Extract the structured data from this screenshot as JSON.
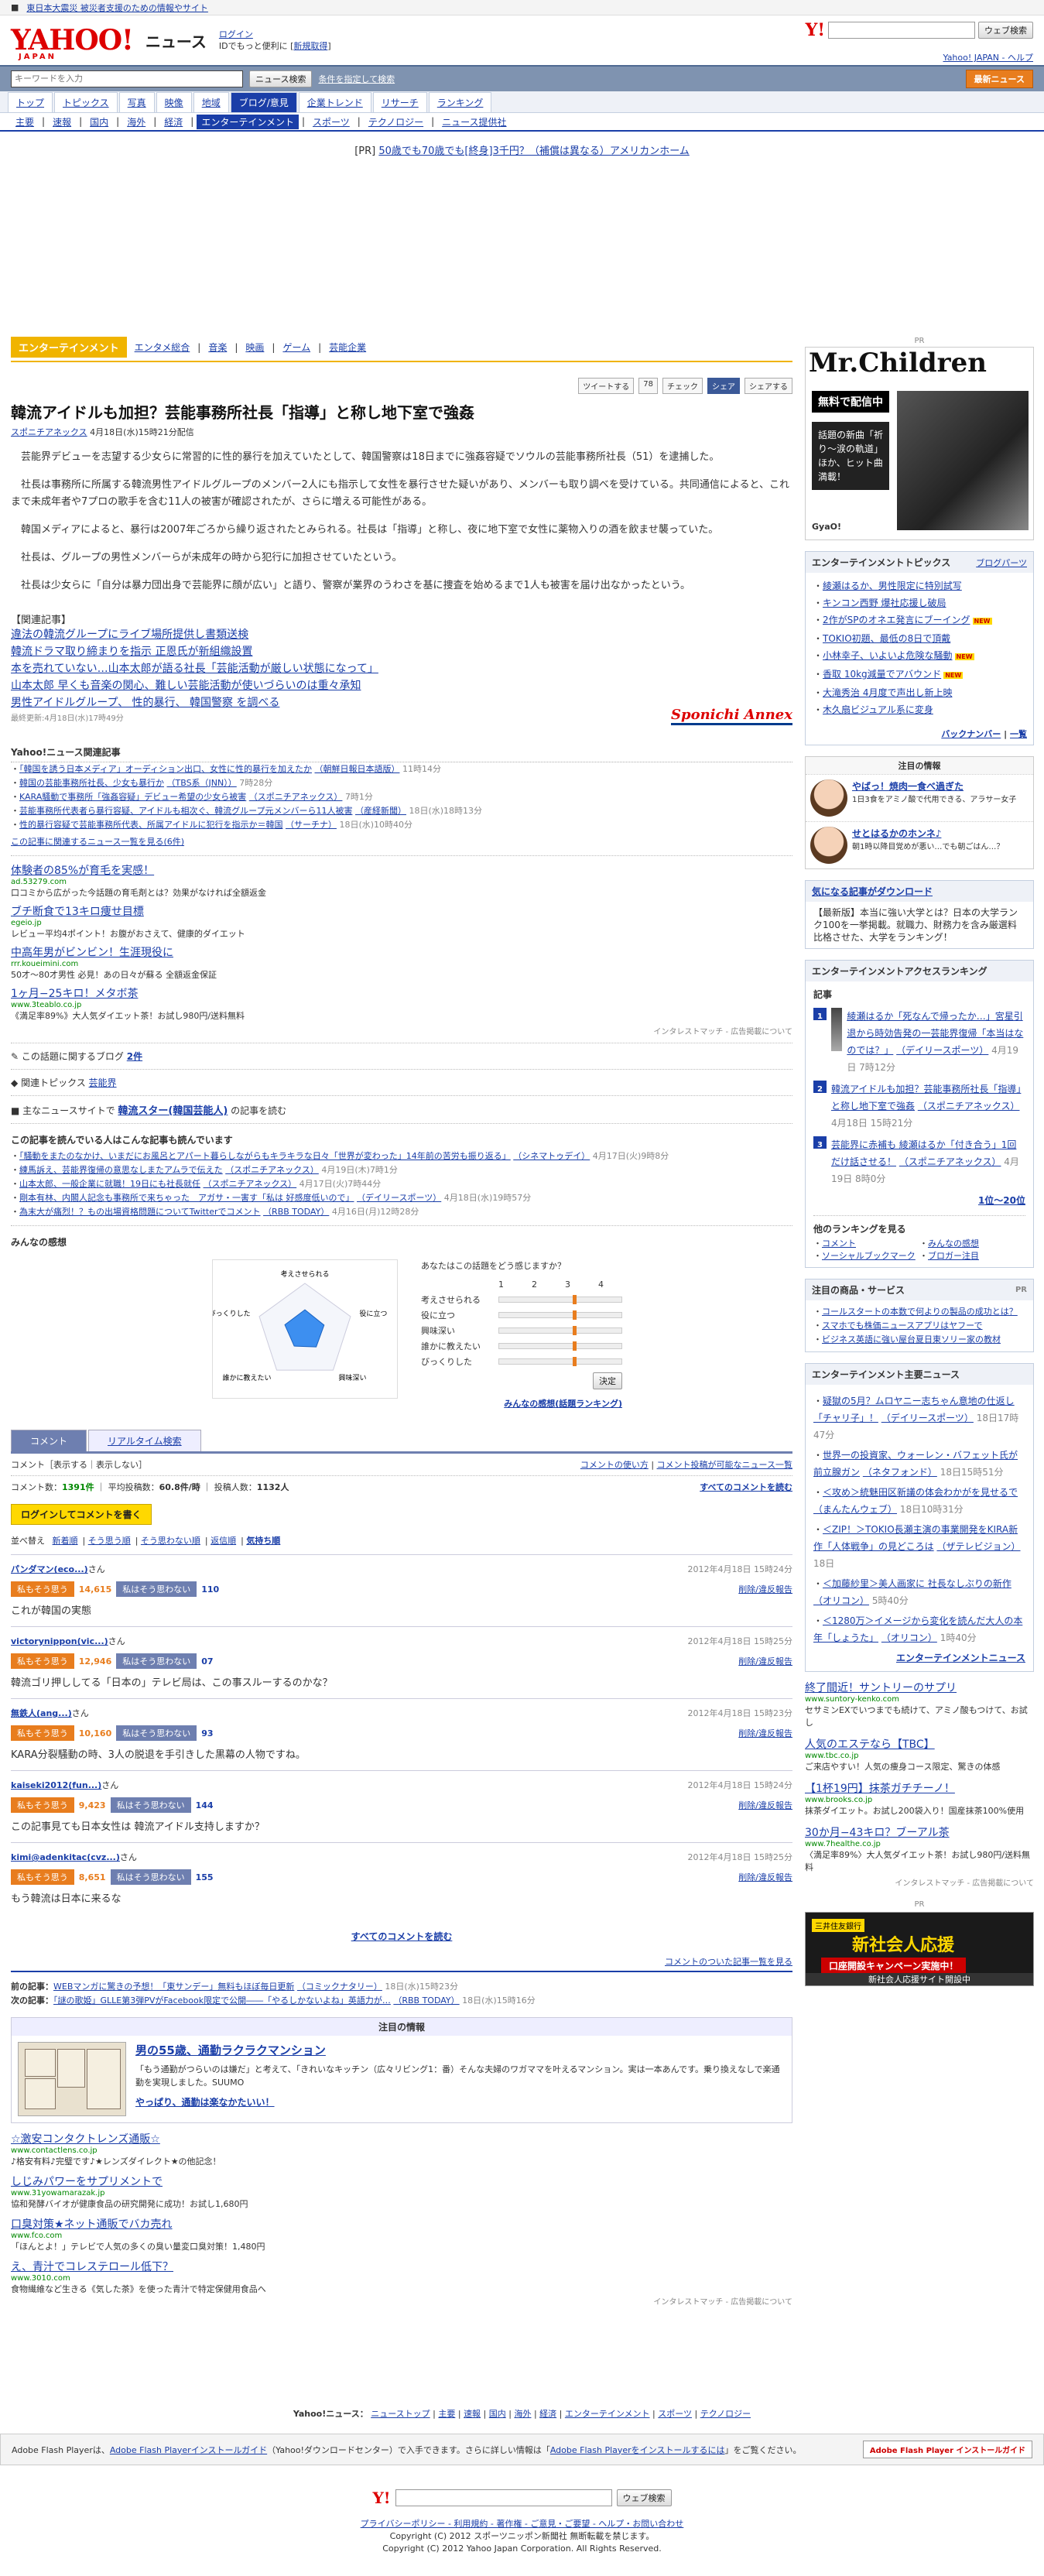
{
  "top_strip": {
    "link1": "東日本大震災 被災者支援のための情報やサイト"
  },
  "header": {
    "logo": "YAHOO!",
    "logo_sub": "JAPAN",
    "site": "ニュース",
    "login": "ログイン",
    "login_sub": "IDでもっと便利に",
    "register": "新規取得",
    "ysearch_btn": "ウェブ検索",
    "links": "Yahoo! JAPAN - ヘルプ"
  },
  "search": {
    "placeholder": "キーワードを入力",
    "btn": "ニュース検索",
    "cond": "条件を指定して検索",
    "fs_btn": "最新ニュース"
  },
  "nav1": [
    "トップ",
    "トピックス",
    "写真",
    "映像",
    "地域",
    "ブログ/意見",
    "企業トレンド",
    "リサーチ",
    "ランキング"
  ],
  "nav2": [
    "主要",
    "速報",
    "国内",
    "海外",
    "経済",
    "エンターテインメント",
    "スポーツ",
    "テクノロジー",
    "ニュース提供社"
  ],
  "pr_top": {
    "label": "[PR]",
    "text": "50歳でも70歳でも[終身]3千円？（補償は異なる）アメリカンホーム"
  },
  "cat": {
    "badge": "エンターテインメント",
    "links": [
      "エンタメ総合",
      "音楽",
      "映画",
      "ゲーム",
      "芸能企業"
    ]
  },
  "share": {
    "tweet": "ツイートする",
    "count": "78",
    "check": "チェック",
    "fb": "シェア",
    "y": "シェアする"
  },
  "article": {
    "title": "韓流アイドルも加担？芸能事務所社長「指導」と称し地下室で強姦",
    "source": "スポニチアネックス",
    "date": "4月18日(水)15時21分配信",
    "p1": "芸能界デビューを志望する少女らに常習的に性的暴行を加えていたとして、韓国警察は18日までに強姦容疑でソウルの芸能事務所社長（51）を逮捕した。",
    "p2": "社長は事務所に所属する韓流男性アイドルグループのメンバー2人にも指示して女性を暴行させた疑いがあり、メンバーも取り調べを受けている。共同通信によると、これまで未成年者や7プロの歌手を含む11人の被害が確認されたが、さらに増える可能性がある。",
    "p3": "韓国メディアによると、暴行は2007年ごろから繰り返されたとみられる。社長は「指導」と称し、夜に地下室で女性に薬物入りの酒を飲ませ襲っていた。",
    "p4": "社長は、グループの男性メンバーらが未成年の時から犯行に加担させていたという。",
    "p5": "社長は少女らに「自分は暴力団出身で芸能界に顔が広い」と語り、警察が業界のうわさを基に捜査を始めるまで1人も被害を届け出なかったという。",
    "rel_h": "【関連記事】",
    "rel": [
      "違法の韓流グループにライブ場所提供し書類送検",
      "韓流ドラマ取り締まりを指示 正恩氏が新組織設置",
      "本を売れていない…山本太郎が語る社長「芸能活動が厳しい状態になって」",
      "山本太郎 早くも音楽の関心、難しい芸能活動が使いづらいのは重々承知",
      "男性アイドルグループ、 性的暴行、 韓国警察 を調べる"
    ],
    "updated": "最終更新:4月18日(水)17時49分",
    "sponichi": "Sponichi Annex"
  },
  "yahoo_rel": {
    "h": "Yahoo!ニュース関連記事",
    "items": [
      {
        "t": "「韓国を誘う日本メディア」オーディション出口、女性に性的暴行を加えたか",
        "s": "（朝鮮日報日本語版）",
        "d": "11時14分"
      },
      {
        "t": "韓国の芸能事務所社長、少女も暴行か",
        "s": "（TBS系（JNN））",
        "d": "7時28分"
      },
      {
        "t": "KARA騒動で事務所「強姦容疑」デビュー希望の少女ら被害",
        "s": "（スポニチアネックス）",
        "d": "7時1分"
      },
      {
        "t": "芸能事務所代表者ら暴行容疑、アイドルも相次ぐ、韓流グループ元メンバーら11人被害",
        "s": "（産経新聞）",
        "d": "18日(水)18時13分"
      },
      {
        "t": "性的暴行容疑で芸能事務所代表、所属アイドルに犯行を指示か＝韓国",
        "s": "（サーチナ）",
        "d": "18日(水)10時40分"
      }
    ],
    "more": "この記事に関連するニュース一覧を見る(6件)"
  },
  "ads1": [
    {
      "t": "体験者の85%が育毛を実感！",
      "u": "ad.53279.com",
      "d": "口コミから広がった今話題の育毛剤とは？効果がなければ全額返金"
    },
    {
      "t": "ブチ断食で13キロ痩せ目標",
      "u": "egeio.jp",
      "d": "レビュー平均4ポイント！お腹がおさえて、健康的ダイエット"
    },
    {
      "t": "中高年男がビンビン！生涯現役に",
      "u": "rrr.koueimini.com",
      "d": "50才〜80才男性 必見！あの日々が蘇る 全額返金保証"
    },
    {
      "t": "1ヶ月−25キロ！メタボ茶",
      "u": "www.3teablo.co.jp",
      "d": "《満足率89%》大人気ダイエット茶！お試し980円/送料無料"
    }
  ],
  "interest": "インタレストマッチ - 広告掲載について",
  "blogs": {
    "label": "この話題に関するブログ",
    "count": "2件"
  },
  "topics": {
    "label": "関連トピックス",
    "link": "芸能界"
  },
  "main_site": {
    "label": "主なニュースサイトで",
    "link": "韓流スター(韓国芸能人)",
    "suffix": "の記事を読む"
  },
  "also_read": {
    "h": "この記事を読んでいる人はこんな記事も読んでいます",
    "items": [
      {
        "t": "「騒動をまたのなかけ、いまだにお風呂とアパート暮らしながらもキラキラな日々「世界が変わった」14年前の苦労も振り返る」",
        "s": "（シネマトゥデイ）",
        "d": "4月17日(火)9時8分"
      },
      {
        "t": "練馬訴え、芸能界復帰の意思なしまたアムラで伝えた",
        "s": "（スポニチアネックス）",
        "d": "4月19日(木)7時1分"
      },
      {
        "t": "山本太郎、一般企業に就職！19日にも社長就任",
        "s": "（スポニチアネックス）",
        "d": "4月17日(火)7時44分"
      },
      {
        "t": "剛本有林、内閣人記念も事務所で来ちゃった　アガサ・一害す「私は 好感度低いので」",
        "s": "（デイリースポーツ）",
        "d": "4月18日(水)19時57分"
      },
      {
        "t": "為末大が痛烈！？もの出場資格問題についてTwitterでコメント",
        "s": "（RBB TODAY）",
        "d": "4月16日(月)12時28分"
      }
    ]
  },
  "kanso": {
    "h": "みんなの感想",
    "q": "あなたはこの話題をどう感じますか？",
    "scale": [
      "1",
      "2",
      "3",
      "4"
    ],
    "axes": [
      "考えさせられる",
      "役に立つ",
      "興味深い",
      "誰かに教えたい",
      "びっくりした"
    ],
    "levels": [
      0.45,
      0.42,
      0.4,
      0.38,
      0.44
    ],
    "btn": "決定",
    "rank": "みんなの感想(話題ランキング)"
  },
  "comments": {
    "tabs": [
      "コメント",
      "リアルタイム検索"
    ],
    "disp": "コメント［表示する｜表示しない］",
    "howto": "コメントの使い方",
    "list": "コメント投稿が可能なニュース一覧",
    "count_label": "コメント数：",
    "count": "1391件",
    "avg_label": "平均投稿数：",
    "avg": "60.8件/時",
    "users_label": "投稿人数：",
    "users": "1132人",
    "all_top": "すべてのコメントを読む",
    "login_btn": "ログインしてコメントを書く",
    "sort": [
      "並べ替え",
      "新着順",
      "そう思う順",
      "そう思わない順",
      "返信順",
      "気持ち順"
    ],
    "yes": "私もそう思う",
    "no": "私はそう思わない",
    "report": "削除/違反報告",
    "items": [
      {
        "u": "パンダマン(eco...)",
        "s": "さん",
        "d": "2012年4月18日 15時24分",
        "y": "14,615",
        "n": "110",
        "t": "これが韓国の実態"
      },
      {
        "u": "victorynippon(vic...)",
        "s": "さん",
        "d": "2012年4月18日 15時25分",
        "y": "12,946",
        "n": "07",
        "t": "韓流ゴリ押ししてる「日本の」テレビ局は、この事スルーするのかな？"
      },
      {
        "u": "無鉄人(ang...)",
        "s": "さん",
        "d": "2012年4月18日 15時23分",
        "y": "10,160",
        "n": "93",
        "t": "KARA分裂騒動の時、3人の脱退を手引きした黒幕の人物ですね。"
      },
      {
        "u": "kaiseki2012(fun...)",
        "s": "さん",
        "d": "2012年4月18日 15時24分",
        "y": "9,423",
        "n": "144",
        "t": "この記事見ても日本女性は 韓流アイドル支持しますか？"
      },
      {
        "u": "kimi@adenkitac(cvz...)",
        "s": "さん",
        "d": "2012年4月18日 15時25分",
        "y": "8,651",
        "n": "155",
        "t": "もう韓流は日本に来るな"
      }
    ],
    "all": "すべてのコメントを読む",
    "ranking": "コメントのついた記事一覧を見る"
  },
  "prevnext": {
    "prev_l": "前の記事：",
    "prev": "WEBマンガに驚きの予想！「東サンデー」無料もほぼ毎日更新",
    "prev_s": "（コミックナタリー）",
    "prev_d": "18日(水)15時23分",
    "next_l": "次の記事：",
    "next": "「謎の歌姫」GLLE第3弾PVがFacebook限定で公開――「やるしかないよね」英語力が…",
    "next_s": "（RBB TODAY）",
    "next_d": "18日(水)15時16分"
  },
  "chumoku": {
    "h": "注目の情報",
    "t": "男の55歳、通勤ラクラクマンション",
    "d": "「もう通勤がつらいのは嫌だ」と考えて、「きれいなキッチン（広々リビング1：番）そんな夫婦のワガママを叶えるマンション。実は一本あんです。乗り換えなしで楽通勤を実現しました。SUUMO",
    "link": "やっぱり、通勤は楽なかたいい！"
  },
  "ads2": [
    {
      "t": "☆激安コンタクトレンズ通販☆",
      "u": "www.contactlens.co.jp",
      "d": "♪格安有料♪完璧です♪★レンズダイレクト★の他記念！"
    },
    {
      "t": "しじみパワーをサプリメントで",
      "u": "www.31yowamarazak.jp",
      "d": "協和発酵バイオが健康食品の研究開発に成功！お試し1,680円"
    },
    {
      "t": "口臭対策★ネット通販でバカ売れ",
      "u": "www.fco.com",
      "d": "「ほんとよ！」テレビで人気の多くの臭い量変口臭対策！1,480円"
    },
    {
      "t": "え、青汁でコレステロール低下？",
      "u": "www.3010.com",
      "d": "食物繊維など生きる《気した茶》を使った青汁で特定保健用食品へ"
    }
  ],
  "interest2": "インタレストマッチ - 広告掲載について",
  "footer_nav": {
    "label": "Yahoo!ニュース：",
    "items": [
      "ニューストップ",
      "主要",
      "速報",
      "国内",
      "海外",
      "経済",
      "エンターテインメント",
      "スポーツ",
      "テクノロジー"
    ]
  },
  "flash": {
    "text1": "Adobe Flash Playerは、",
    "link1": "Adobe Flash Playerインストールガイド",
    "text2": "（Yahoo!ダウンロードセンター）で入手できます。さらに詳しい情報は「",
    "link2": "Adobe Flash Playerをインストールするには",
    "text3": "」をご覧ください。",
    "btn": "Adobe Flash Player インストールガイド"
  },
  "fsearch_btn": "ウェブ検索",
  "copyright": {
    "links": "プライバシーポリシー - 利用規約 - 著作権 - ご意見・ご要望 - ヘルプ・お問い合わせ",
    "l2": "Copyright (C) 2012 スポーツニッポン新聞社 無断転載を禁じます。",
    "l3": "Copyright (C) 2012 Yahoo Japan Corporation. All Rights Reserved."
  },
  "side": {
    "pr": "PR",
    "mc_title": "Mr.Children",
    "mc_free": "無料で配信中",
    "mc_sub": "話題の新曲「祈り〜涙の軌道」ほか、ヒット曲満載！",
    "mc_gy": "GyaO!",
    "topics_h": "エンターテインメントトピックス",
    "topics_blog": "ブログパーツ",
    "topics": [
      "綾瀬はるか、男性限定に特別試写",
      "キンコン西野 爆社応援し破局",
      "2作がSPのオネエ発言にブーイング",
      "TOKIO初題、最低の8日で頂戴",
      "小林幸子、いよいよ危険な騒動",
      "香取 10kg減量でアバウンド",
      "大滝秀治 4月度で声出し新上映",
      "木久扇ビジュアル系に変身"
    ],
    "topics_new": [
      false,
      false,
      true,
      false,
      true,
      true,
      false,
      false
    ],
    "topics_more1": "バックナンバー",
    "topics_more2": "一覧",
    "attn_h": "注目の情報",
    "attn": [
      {
        "t": "やばっ！焼肉一食べ過ぎた",
        "d": "1日3食をアミノ酸で代用できる、アラサー女子"
      },
      {
        "t": "せとはるかのホンネ♪",
        "d": "朝1時以降目覚めが悪い…でも朝ごはん…？"
      }
    ],
    "down_h": "気になる記事がダウンロード",
    "down_d": "【最新版】本当に強い大学とは？日本の大学ランク100を一挙掲載。就職力、財務力を含み厳選料比格させた、大学をランキング！",
    "access_h": "エンターテインメントアクセスランキング",
    "access_sub": "記事",
    "rank": [
      {
        "n": "1",
        "t": "綾瀬はるか「死なんで帰ったか…」宮星引退から時効告発の一芸能界復帰「本当はなのでは？」",
        "s": "（デイリースポーツ）",
        "d": "4月19日 7時12分"
      },
      {
        "n": "2",
        "t": "韓流アイドルも加担？芸能事務所社長「指導」と称し地下室で強姦",
        "s": "（スポニチアネックス）",
        "d": "4月18日 15時21分"
      },
      {
        "n": "3",
        "t": "芸能界に赤補も 綾瀬はるか「付き合う」1回だけ話させる！",
        "s": "（スポニチアネックス）",
        "d": "4月19日 8時0分"
      }
    ],
    "access_more": "1位〜20位",
    "other_h": "他のランキングを見る",
    "other": [
      "コメント",
      "みんなの感想",
      "ソーシャルブックマーク",
      "ブロガー注目"
    ],
    "prod_h": "注目の商品・サービス",
    "prod": [
      "コールスタートの本数で何よりの製品の成功とは？",
      "スマホでも株価ニュースアプリはヤフーで",
      "ビジネス英語に強い屋台夏日東ソリー家の教材"
    ],
    "ent_h": "エンターテインメント主要ニュース",
    "ent": [
      {
        "t": "疑獄の5月？ムロヤニー志ちゃん意地の仕返し「チャリ子」！",
        "s": "（デイリースポーツ）",
        "d": "18日17時47分"
      },
      {
        "t": "世界一の投資家、ウォーレン・バフェット氏が前立腺ガン",
        "s": "（ネタフォンド）",
        "d": "18日15時51分"
      },
      {
        "t": "＜攻め＞統魅田区新議の体会わかがを見せるで（まんたんウェブ）",
        "s": "",
        "d": "18日10時31分"
      },
      {
        "t": "＜ZIP！＞TOKIO長瀬主演の事業開発をKIRA新作「人体戦争」の見どころは",
        "s": "（ザテレビジョン）",
        "d": "18日"
      },
      {
        "t": "＜加藤紗里＞美人画家に 社長なしぶりの新作",
        "s": "（オリコン）",
        "d": "5時40分"
      },
      {
        "t": "＜1280万＞イメージから変化を読んだ大人の本年「しょうた」",
        "s": "（オリコン）",
        "d": "1時40分"
      }
    ],
    "ent_more": "エンターテインメントニュース",
    "ads": [
      {
        "t": "終了間近！サントリーのサプリ",
        "u": "www.suntory-kenko.com",
        "d": "セサミンEXでいつまでも続けて、アミノ酸もつけて、お試し"
      },
      {
        "t": "人気のエステなら【TBC】",
        "u": "www.tbc.co.jp",
        "d": "ご来店やすい！人気の痩身コース限定、驚きの体感"
      },
      {
        "t": "【1杯19円】抹茶ガチチーノ！",
        "u": "www.brooks.co.jp",
        "d": "抹茶ダイエット。お試し200袋入り！国産抹茶100%使用"
      },
      {
        "t": "30か月−43キロ？ブーアル茶",
        "u": "www.7healthe.co.jp",
        "d": "〈満足率89%〉大人気ダイエット茶！お試し980円/送料無料"
      }
    ],
    "interest": "インタレストマッチ - 広告掲載について",
    "pr2": "PR",
    "banner_a": "三井住友銀行",
    "banner_b": "新社会人応援",
    "banner_c": "口座開設キャンペーン実施中！",
    "banner_d": "新社会人応援サイト開設中"
  }
}
